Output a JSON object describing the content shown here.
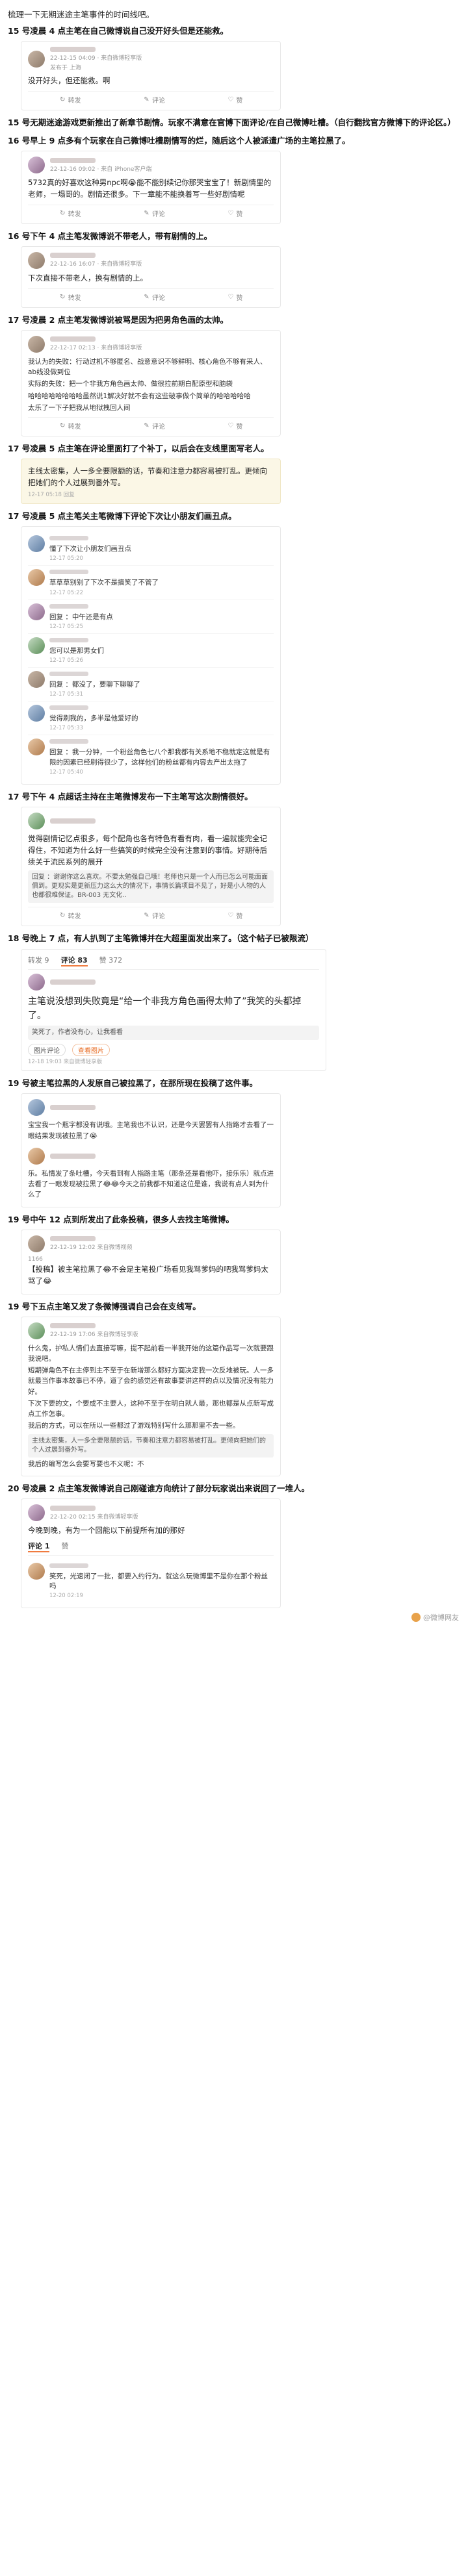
{
  "intro": "梳理一下无期迷途主笔事件的时间线吧。",
  "events": [
    {
      "title": "15 号凌晨 4 点主笔在自己微博说自己没开好头但是还能救。",
      "post": {
        "meta": "22-12-15 04:09 · 来自微博轻享版",
        "meta2": "发布于 上海",
        "text": "没开好头，但还能救。啊",
        "actions": [
          "转发",
          "评论",
          "赞"
        ]
      }
    },
    {
      "title": "15 号无期迷途游戏更新推出了新章节剧情。玩家不满意在官博下面评论/在自己微博吐槽。（自行翻找官方微博下的评论区。）"
    },
    {
      "title": "16 号早上 9 点多有个玩家在自己微博吐槽剧情写的烂，随后这个人被派遣广场的主笔拉黑了。",
      "post": {
        "meta": "22-12-16 09:02 · 来自 iPhone客户端",
        "text": "5732真的好喜欢这种男npc啊😭能不能别续记你那哭宝宝了！新剧情里的老师，一塌哥的。剧情还很多。下一章能不能换着写一些好剧情呢",
        "actions": [
          "转发",
          "评论",
          "赞"
        ]
      }
    },
    {
      "title": "16 号下午 4 点主笔发微博说不带老人，带有剧情的上。",
      "post": {
        "meta": "22-12-16 16:07 · 来自微博轻享版",
        "text": "下次直接不带老人，换有剧情的上。",
        "actions": [
          "转发",
          "评论",
          "赞"
        ]
      }
    },
    {
      "title": "17 号凌晨 2 点主笔发微博说被骂是因为把男角色画的太帅。",
      "post": {
        "meta": "22-12-17 02:13 · 来自微博轻享版",
        "lines": [
          "我认为的失败：行动过机不够匿名、战意意识不够鲜明、核心角色不够有采人、ab线没做到位",
          "实际的失败：把一个非我方角色画太帅、做很拉前期白配原型和脑袋",
          "哈哈哈哈哈哈哈哈虽然说1解决好就不会有这些破事做个简单的哈哈哈哈哈",
          "太乐了一下子把我从地狱拽回人间"
        ],
        "actions": [
          "转发",
          "评论",
          "赞"
        ]
      }
    },
    {
      "title": "17 号凌晨 5 点主笔在评论里面打了个补丁，以后会在支线里面写老人。",
      "post": {
        "text": "主线太密集，人一多全要限额的话，节奏和注意力都容易被打乱。更倾向把她们的个人过展到番外写。",
        "meta": "12-17 05:18 回复"
      }
    },
    {
      "title": "17 号凌晨 5 点主笔关主笔微博下评论下次让小朋友们画丑点。",
      "comments": [
        {
          "text": "懂了下次让小朋友们画丑点",
          "meta": "12-17 05:20"
        },
        {
          "text": "草草草别别了下次不是搞笑了不管了",
          "meta": "12-17 05:22"
        },
        {
          "text": "回复 ：中午还是有点",
          "meta": "12-17 05:25"
        },
        {
          "text": "您可以是那男女们",
          "meta": "12-17 05:26"
        },
        {
          "text": "回复 ：都没了，要聊下聊聊了",
          "meta": "12-17 05:31"
        },
        {
          "text": "觉得刷我的，多半是他爱好的",
          "meta": "12-17 05:33"
        },
        {
          "text": "回复 ：我一分钟，一个粉丝角色七八个那我都有关系地不稳就定这就是有限的因素已经刷得很少了，这样他们的粉丝都有内容去产出太拖了",
          "meta": "12-17 05:40"
        }
      ]
    },
    {
      "title": "17 号下午 4 点超话主持在主笔微博发布一下主笔写这次剧情很好。",
      "post": {
        "text": "觉得剧情记忆点很多，每个配角也各有特色有看有肉，看一遍就能完全记得住，不知道为什么好一些搞笑的时候完全没有注意到的事情。好期待后续关于流民系列的展开",
        "reply": "回复 ：谢谢你这么喜欢。不要太勉强自己哦！老师也只是一个人而已怎么可能面面俱到。更现实是更新压力这么大的情况下，事情长篇项目不见了，好是小人物的人也都很难保证。BR-003 无文化..",
        "actions": [
          "转发",
          "评论",
          "赞"
        ]
      }
    },
    {
      "title": "18 号晚上 7 点，有人扒到了主笔微博并在大超里面发出来了。（这个帖子已被限流）",
      "post": {
        "tabs": [
          "转发 9",
          "评论 83",
          "赞 372"
        ],
        "big": "主笔说没想到失败竟是“给一个非我方角色画得太帅了”我笑的头都掉了。",
        "reply": "笑死了，作者没有心，让我看看",
        "actions": [
          "图片评论",
          "查看图片"
        ],
        "meta": "12-18 19:03 来自微博轻享版"
      }
    },
    {
      "title": "19 号被主笔拉黑的人发原自己被拉黑了，在那所现在投稿了这件事。",
      "post": {
        "lines": [
          "宝宝我一个瓶字都没有说哦。主笔我也不认识，还是今天罢罢有人指路才去看了一眼结果发现被拉黑了😭",
          "乐。私情发了条吐槽，今天看到有人指路主笔（那条还是看他吓，接乐乐）就点进去看了一眼发现被拉黑了😂😂今天之前我都不知道这位是谁，我说有点人到为什么了"
        ]
      }
    },
    {
      "title": "19 号中午 12 点到所发出了此条投稿，很多人去找主笔微博。",
      "post": {
        "meta": "22-12-19 12:02 来自微博视频",
        "count": "1166",
        "text": "【投稿】被主笔拉黑了😂不会是主笔投广场看见我骂爹妈的吧我骂爹妈太骂了😂"
      }
    },
    {
      "title": "19 号下五点主笔又发了条微博强调自己会在支线写。",
      "post": {
        "meta": "22-12-19 17:06 来自微博轻享版",
        "lines": [
          "什么鬼，护私人情们去直接写嘛，提不起前看一半我开始的这篇作品写一次就要跟我说吧。",
          "短期弹角色不在主停到主不至于在新增那么都好方面决定我一次反地被玩。人一多就最当作事本故事已不停，道了会的感觉还有故事要讲这样的点以及情况没有能力好。",
          "下次下要的文，个要成不主要人，这种不至于在明白就人最，那也都是从点新写成点工作怎事。",
          "我后的方式，可以在所以一些都过了游戏特别写什么那那里不去一些。"
        ],
        "reply": "主线太密集，人一多全要限额的话，节奏和注意力都容易被打乱。更倾向把她们的个人过展到番外写。",
        "text2": "我后的编写怎么会要写要也不义呢：不"
      }
    },
    {
      "title": "20 号凌晨 2 点主笔发微博说自己刚碰谁方向统计了部分玩家说出来说回了一堆人。",
      "post": {
        "meta": "22-12-20 02:15 来自微博轻享版",
        "text": "今晚到晚，有为一个回能以下前提所有加的那好",
        "tabs": [
          "评论 1",
          "赞"
        ],
        "comment": "笑死，光速闭了一批，都要入约行为。就这么玩微博里不是你在那个粉丝吗",
        "comment_meta": "12-20 02:19"
      }
    }
  ],
  "watermark": "@微博网友"
}
